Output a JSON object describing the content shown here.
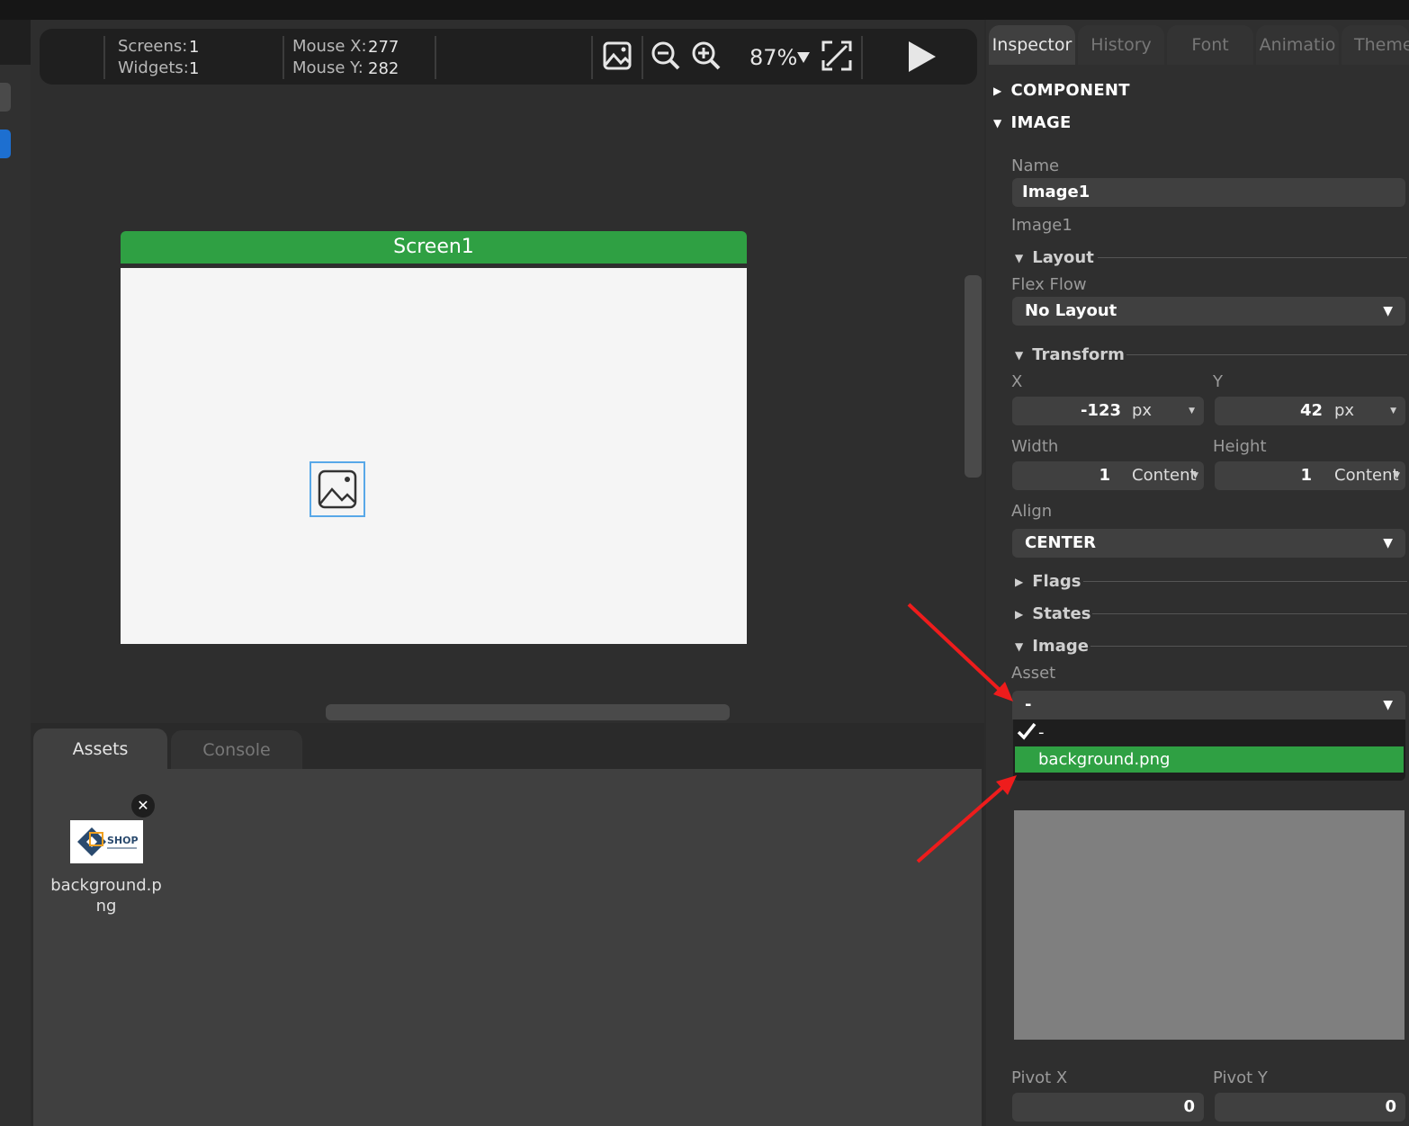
{
  "toolbar": {
    "screens_label": "Screens:",
    "screens_value": "1",
    "widgets_label": "Widgets:",
    "widgets_value": "1",
    "mouse_x_label": "Mouse X:",
    "mouse_x_value": "277",
    "mouse_y_label": "Mouse Y:",
    "mouse_y_value": "282",
    "zoom": "87%",
    "icons": [
      "image-icon",
      "zoom-out-icon",
      "zoom-in-icon",
      "dropdown-arrow-icon",
      "fit-screen-icon",
      "play-icon"
    ]
  },
  "canvas": {
    "screen_title": "Screen1"
  },
  "bottom_tabs": {
    "assets": "Assets",
    "console": "Console"
  },
  "assets": [
    {
      "name": "background.png",
      "thumb_text": "SHOP"
    }
  ],
  "inspector": {
    "tabs": [
      "Inspector",
      "History",
      "Font",
      "Animatio",
      "Theme"
    ],
    "sections": {
      "component": "COMPONENT",
      "image": "IMAGE"
    },
    "name_label": "Name",
    "name_value": "Image1",
    "name_sub": "Image1",
    "layout_title": "Layout",
    "flex_flow_label": "Flex Flow",
    "flex_flow_value": "No Layout",
    "transform_title": "Transform",
    "x_label": "X",
    "x_value": "-123",
    "x_unit": "px",
    "y_label": "Y",
    "y_value": "42",
    "y_unit": "px",
    "width_label": "Width",
    "width_value": "1",
    "width_unit": "Content",
    "height_label": "Height",
    "height_value": "1",
    "height_unit": "Content",
    "align_label": "Align",
    "align_value": "CENTER",
    "flags_title": "Flags",
    "states_title": "States",
    "image_title": "Image",
    "asset_label": "Asset",
    "asset_value": "-",
    "asset_options": [
      "-",
      "background.png"
    ],
    "pivot_x_label": "Pivot X",
    "pivot_x_value": "0",
    "pivot_y_label": "Pivot Y",
    "pivot_y_value": "0"
  },
  "colors": {
    "accent_green": "#2fa043",
    "selection_blue": "#58a8e8",
    "annotation_red": "#ee1c1c"
  }
}
